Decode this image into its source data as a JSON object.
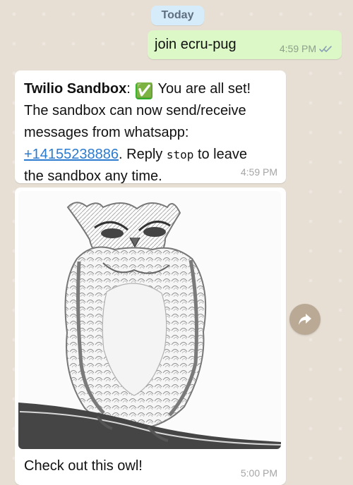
{
  "chat": {
    "date_separator": "Today",
    "outgoing_message": {
      "text": "join ecru-pug",
      "time": "4:59 PM"
    },
    "incoming_message": {
      "sender": "Twilio Sandbox",
      "separator": ":",
      "emoji": "✅",
      "status_text": "You are all set!",
      "line_2": "The sandbox can now send/receive",
      "line_3": "messages from whatsapp:",
      "phone": "+14155238886",
      "reply_prefix": ". Reply ",
      "stop_keyword": "stop",
      "reply_suffix": " to leave",
      "line_5": "the sandbox any time.",
      "time": "4:59 PM"
    },
    "image_message": {
      "caption": "Check out this owl!",
      "time": "5:00 PM"
    }
  },
  "icons": {
    "read_receipt": "double-check-icon",
    "forward": "forward-icon",
    "owl_image": "owl-image"
  },
  "colors": {
    "outgoing_bubble": "#dcf8c6",
    "incoming_bubble": "#ffffff",
    "date_pill": "#d7ecfa",
    "link": "#2a7bd0"
  }
}
